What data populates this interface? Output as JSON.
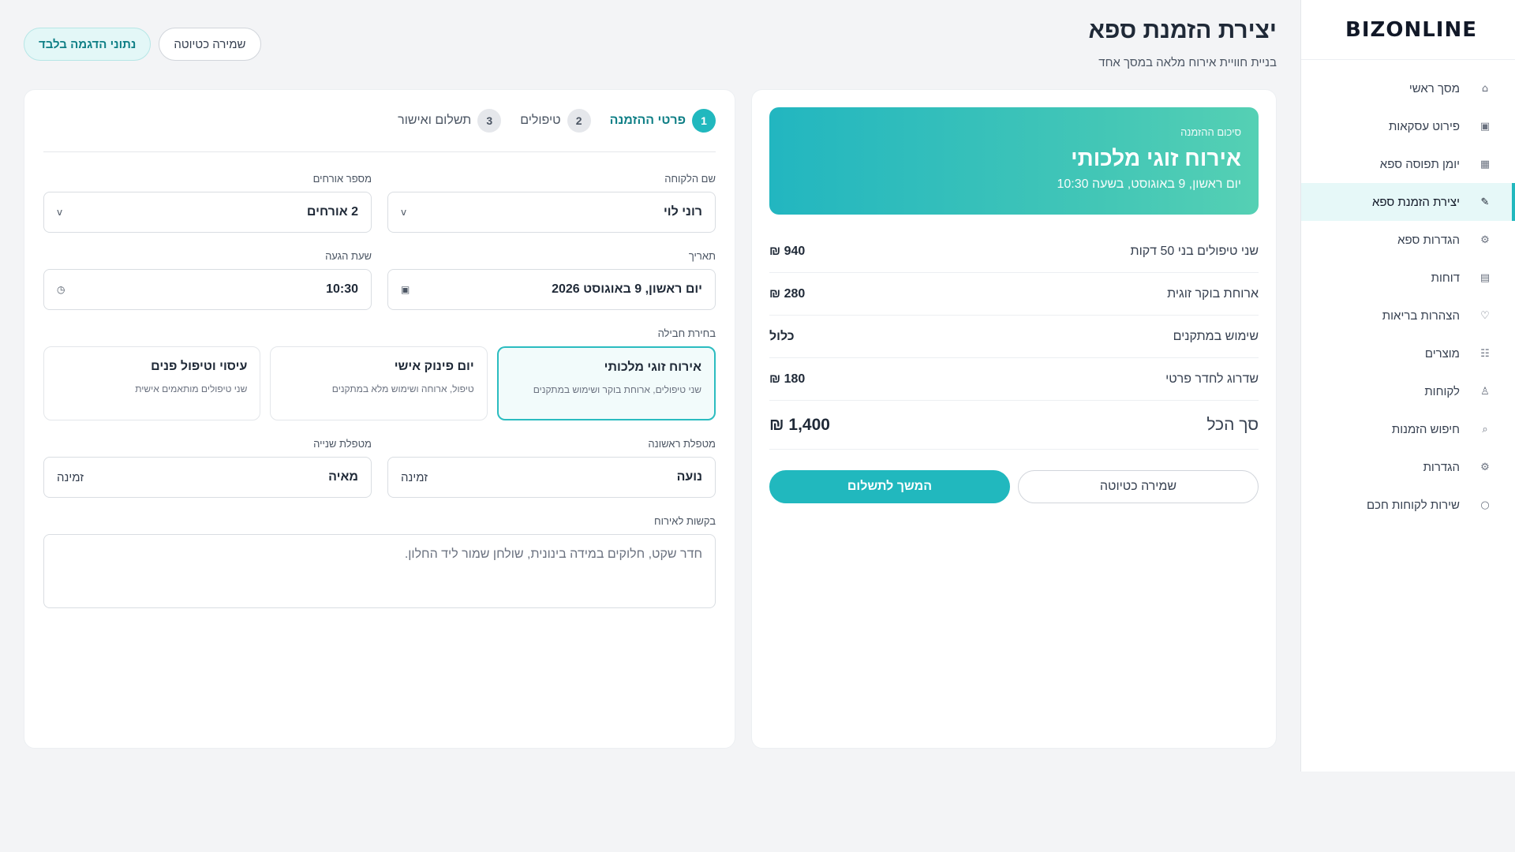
{
  "sidebar": {
    "logo": "BIZONLINE",
    "items": [
      {
        "label": "מסך ראשי",
        "icon": "home-icon",
        "glyph": "⌂"
      },
      {
        "label": "פירוט עסקאות",
        "icon": "transactions-icon",
        "glyph": "▣"
      },
      {
        "label": "יומן תפוסה ספא",
        "icon": "calendar-grid-icon",
        "glyph": "▦"
      },
      {
        "label": "יצירת הזמנת ספא",
        "icon": "pencil-icon",
        "glyph": "✎"
      },
      {
        "label": "הגדרות ספא",
        "icon": "spa-settings-icon",
        "glyph": "⚙"
      },
      {
        "label": "דוחות",
        "icon": "reports-icon",
        "glyph": "▤"
      },
      {
        "label": "הצהרות בריאות",
        "icon": "heart-icon",
        "glyph": "♡"
      },
      {
        "label": "מוצרים",
        "icon": "products-icon",
        "glyph": "☷"
      },
      {
        "label": "לקוחות",
        "icon": "user-icon",
        "glyph": "♙"
      },
      {
        "label": "חיפוש הזמנות",
        "icon": "search-icon",
        "glyph": "⌕"
      },
      {
        "label": "הגדרות",
        "icon": "gear-icon",
        "glyph": "⚙"
      },
      {
        "label": "שירות לקוחות חכם",
        "icon": "chat-icon",
        "glyph": "○"
      }
    ],
    "active_index": 3
  },
  "header": {
    "title": "יצירת הזמנת ספא",
    "subtitle": "בניית חוויית אירוח מלאה במסך אחד",
    "demo_badge": "נתוני הדגמה בלבד",
    "save_draft": "שמירה כטיוטה"
  },
  "summary": {
    "label": "סיכום ההזמנה",
    "title": "אירוח זוגי מלכותי",
    "date": "יום ראשון, 9 באוגוסט, בשעה 10:30",
    "lines": [
      {
        "label": "שני טיפולים בני 50 דקות",
        "amount": "940 ₪"
      },
      {
        "label": "ארוחת בוקר זוגית",
        "amount": "280 ₪"
      },
      {
        "label": "שימוש במתקנים",
        "amount": "כלול"
      },
      {
        "label": "שדרוג לחדר פרטי",
        "amount": "180 ₪"
      }
    ],
    "total_label": "סך הכל",
    "total_amount": "1,400 ₪",
    "save_draft": "שמירה כטיוטה",
    "continue": "המשך לתשלום"
  },
  "form": {
    "steps": [
      {
        "num": "1",
        "label": "פרטי ההזמנה"
      },
      {
        "num": "2",
        "label": "טיפולים"
      },
      {
        "num": "3",
        "label": "תשלום ואישור"
      }
    ],
    "active_step": 0,
    "customer_label": "שם הלקוחה",
    "customer_value": "רוני לוי",
    "guests_label": "מספר אורחים",
    "guests_value": "2 אורחים",
    "date_label": "תאריך",
    "date_value": "יום ראשון, 9 באוגוסט 2026",
    "arrival_label": "שעת הגעה",
    "arrival_value": "10:30",
    "package_label": "בחירת חבילה",
    "packages": [
      {
        "title": "אירוח זוגי מלכותי",
        "desc": "שני טיפולים, ארוחת בוקר ושימוש במתקנים"
      },
      {
        "title": "יום פינוק אישי",
        "desc": "טיפול, ארוחה ושימוש מלא במתקנים"
      },
      {
        "title": "עיסוי וטיפול פנים",
        "desc": "שני טיפולים מותאמים אישית"
      }
    ],
    "selected_package": 0,
    "therapist1_label": "מטפלת ראשונה",
    "therapist1_value": "נועה",
    "therapist1_status": "זמינה",
    "therapist2_label": "מטפלת שנייה",
    "therapist2_value": "מאיה",
    "therapist2_status": "זמינה",
    "requests_label": "בקשות לאירוח",
    "requests_value": "חדר שקט, חלוקים במידה בינונית, שולחן שמור ליד החלון."
  },
  "colors": {
    "accent": "#21b8be",
    "accent_dark": "#0f7f86",
    "banner_start": "#22b6c0",
    "banner_end": "#55d0b4"
  }
}
